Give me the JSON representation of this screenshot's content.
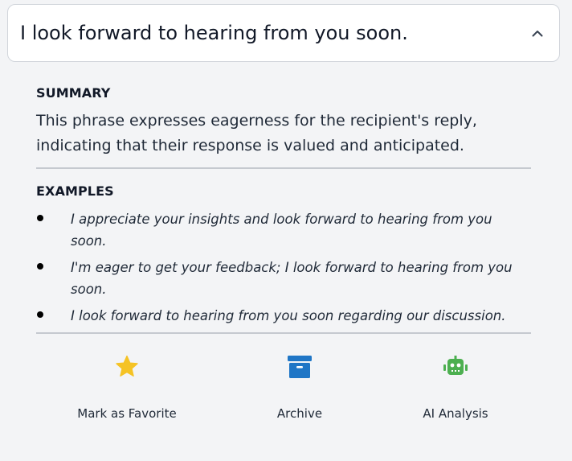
{
  "header": {
    "title": "I look forward to hearing from you soon.",
    "chevron_icon": "chevron-up-icon"
  },
  "summary": {
    "label": "SUMMARY",
    "text": "This phrase expresses eagerness for the recipient's reply, indicating that their response is valued and anticipated."
  },
  "examples": {
    "label": "EXAMPLES",
    "items": [
      "I appreciate your insights and look forward to hearing from you soon.",
      "I'm eager to get your feedback; I look forward to hearing from you soon.",
      "I look forward to hearing from you soon regarding our discussion."
    ]
  },
  "actions": [
    {
      "label": "Mark as Favorite",
      "icon": "star-icon",
      "color": "#f5c325"
    },
    {
      "label": "Archive",
      "icon": "archive-icon",
      "color": "#1f76c6"
    },
    {
      "label": "AI Analysis",
      "icon": "robot-icon",
      "color": "#4caf50"
    }
  ]
}
